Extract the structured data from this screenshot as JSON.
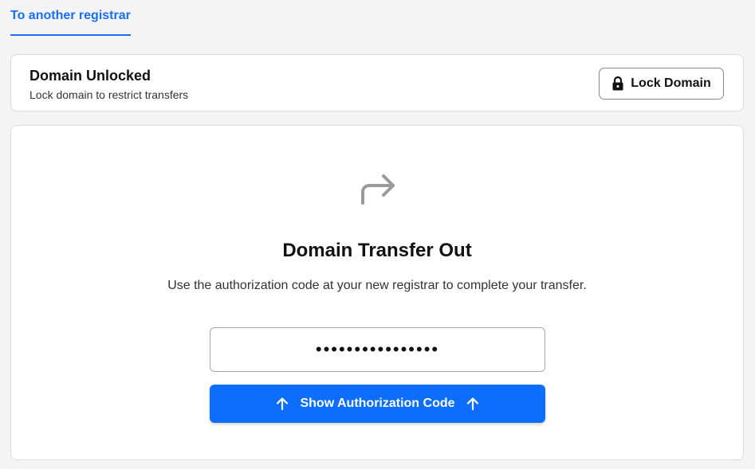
{
  "tabs": [
    {
      "label": "To another registrar",
      "active": true
    }
  ],
  "status": {
    "title": "Domain Unlocked",
    "subtitle": "Lock domain to restrict transfers",
    "lock_button_label": "Lock Domain",
    "lock_icon": "lock-icon"
  },
  "transfer": {
    "icon": "share-forward-icon",
    "title": "Domain Transfer Out",
    "description": "Use the authorization code at your new registrar to complete your transfer.",
    "code_value": "••••••••••••••••",
    "show_button_label": "Show Authorization Code",
    "show_button_icon": "arrow-up-icon"
  },
  "colors": {
    "accent": "#0d6efd",
    "tab_accent": "#1a6ef5",
    "background": "#f4f4f4"
  }
}
